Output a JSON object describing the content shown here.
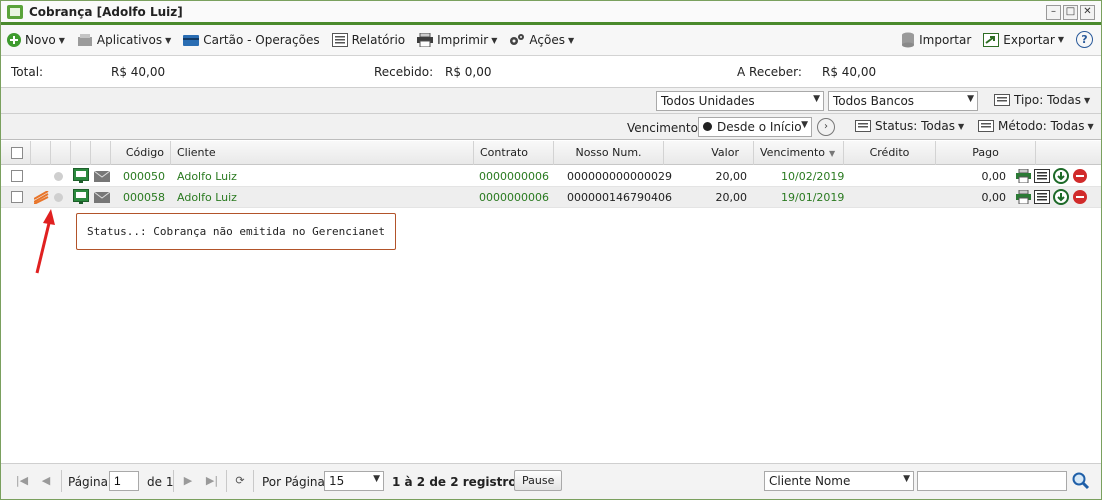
{
  "window": {
    "title": "Cobrança [Adolfo Luiz]"
  },
  "toolbar": {
    "novo": "Novo",
    "aplicativos": "Aplicativos",
    "cartao": "Cartão - Operações",
    "relatorio": "Relatório",
    "imprimir": "Imprimir",
    "acoes": "Ações",
    "importar": "Importar",
    "exportar": "Exportar",
    "help": "?"
  },
  "totals": {
    "total_label": "Total:",
    "total_value": "R$ 40,00",
    "recebido_label": "Recebido:",
    "recebido_value": "R$ 0,00",
    "areceber_label": "A Receber:",
    "areceber_value": "R$ 40,00"
  },
  "filters": {
    "unidades": "Todos Unidades",
    "bancos": "Todos Bancos",
    "tipo": "Tipo: Todas",
    "vencimento_label": "Vencimento:",
    "vencimento_value": "Desde o Início",
    "status": "Status: Todas",
    "metodo": "Método: Todas"
  },
  "grid": {
    "columns": [
      "Código",
      "Cliente",
      "Contrato",
      "Nosso Num.",
      "Valor",
      "Vencimento",
      "Crédito",
      "Pago"
    ],
    "rows": [
      {
        "codigo": "000050",
        "cliente": "Adolfo Luiz",
        "contrato": "0000000006",
        "nosso": "000000000000029",
        "valor": "20,00",
        "vencimento": "10/02/2019",
        "credito": "",
        "pago": "0,00"
      },
      {
        "codigo": "000058",
        "cliente": "Adolfo Luiz",
        "contrato": "0000000006",
        "nosso": "000000146790406",
        "valor": "20,00",
        "vencimento": "19/01/2019",
        "credito": "",
        "pago": "0,00"
      }
    ]
  },
  "tooltip": {
    "text": "Status..: Cobrança não emitida no Gerencianet"
  },
  "footer": {
    "pagina_label": "Página",
    "pagina_value": "1",
    "de_label": "de 1",
    "por_pagina_label": "Por Página:",
    "por_pagina_value": "15",
    "registros": "1 à 2 de 2 registro(s)",
    "pause": "Pause",
    "search_field": "Cliente Nome",
    "search_placeholder": ""
  },
  "colors": {
    "accent_green": "#4a8a2c",
    "link_green": "#2a7a20",
    "tooltip_border": "#b2532a",
    "annotation_arrow": "#e02020"
  }
}
